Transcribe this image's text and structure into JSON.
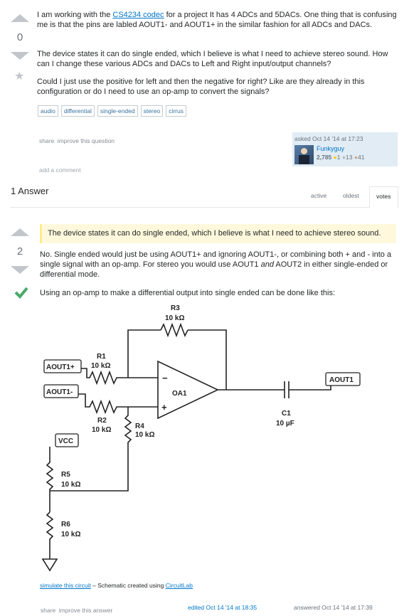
{
  "question": {
    "score": "0",
    "para1_prefix": "I am working with the ",
    "para1_link": "CS4234 codec",
    "para1_suffix": " for a project It has 4 ADCs and 5DACs. One thing that is confusing me is that the pins are labled AOUT1- and AOUT1+ in the similar fashion for all ADCs and DACs.",
    "para2": "The device states it can do single ended, which I believe is what I need to achieve stereo sound. How can I change these various ADCs and DACs to Left and Right input/output channels?",
    "para3": "Could I just use the positive for left and then the negative for right? Like are they already in this configuration or do I need to use an op-amp to convert the signals?",
    "tags": [
      "audio",
      "differential",
      "single-ended",
      "stereo",
      "cirrus"
    ],
    "share": "share",
    "improve": "improve this question",
    "asked": "asked Oct 14 '14 at 17:23",
    "user": {
      "name": "Funkyguy",
      "rep": "2,785",
      "gold": "1",
      "silver": "13",
      "bronze": "41"
    },
    "add_comment": "add a comment"
  },
  "answers_header": {
    "count_label": "1 Answer",
    "tabs": [
      "active",
      "oldest",
      "votes"
    ],
    "active_tab": "votes"
  },
  "answer": {
    "score": "2",
    "quote": "The device states it can do single ended, which I believe is what I need to achieve stereo sound.",
    "para1_prefix": "No. Single ended would just be using AOUT1+ and ignoring AOUT1-, or combining both + and - into a single signal with an op-amp. For stereo you would use AOUT1 ",
    "para1_em": "and",
    "para1_suffix": " AOUT2 in either single-ended or differential mode.",
    "para2": "Using an op-amp to make a differential output into single ended can be done like this:",
    "schematic": {
      "R3": "R3",
      "R3_val": "10 kΩ",
      "R1": "R1",
      "R1_val": "10 kΩ",
      "R2": "R2",
      "R2_val": "10 kΩ",
      "R4": "R4",
      "R4_val": "10 kΩ",
      "R5": "R5",
      "R5_val": "10 kΩ",
      "R6": "R6",
      "R6_val": "10 kΩ",
      "C1": "C1",
      "C1_val": "10 µF",
      "OA1": "OA1",
      "minus": "−",
      "plus": "+",
      "aout1p": "AOUT1+",
      "aout1m": "AOUT1-",
      "aout1": "AOUT1",
      "vcc": "VCC"
    },
    "caption_link": "simulate this circuit",
    "caption_mid": " – Schematic created using ",
    "caption_link2": "CircuitLab",
    "share": "share",
    "improve": "improve this answer",
    "edited": "edited Oct 14 '14 at 18:35",
    "answered": "answered Oct 14 '14 at 17:39"
  }
}
